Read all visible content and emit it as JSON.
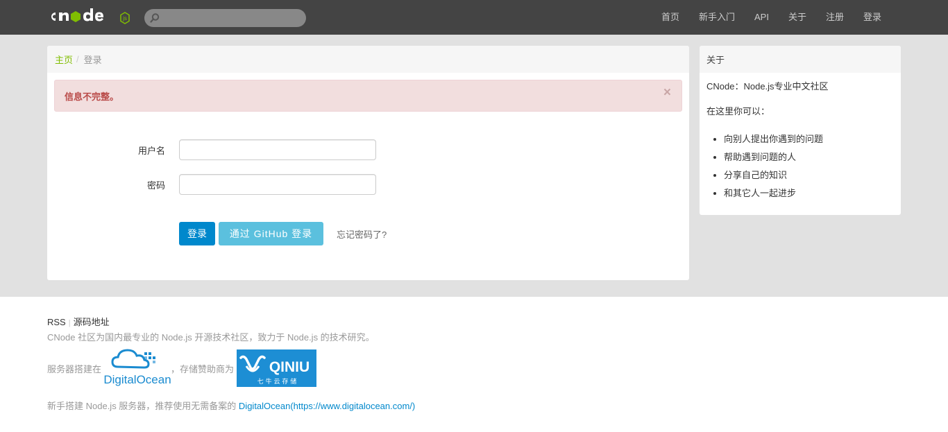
{
  "navbar": {
    "brand_logo": "cnode-logo",
    "search_placeholder": "",
    "items": [
      "首页",
      "新手入门",
      "API",
      "关于",
      "注册",
      "登录"
    ]
  },
  "breadcrumb": {
    "home": "主页",
    "separator": "/",
    "current": "登录"
  },
  "alert": {
    "message": "信息不完整。",
    "close": "×"
  },
  "form": {
    "username_label": "用户名",
    "username_value": "",
    "password_label": "密码",
    "password_value": "",
    "login_button": "登录",
    "github_button": "通过 GitHub 登录",
    "forgot_link": "忘记密码了?"
  },
  "sidebar": {
    "title": "关于",
    "intro": "CNode：Node.js专业中文社区",
    "subtitle": "在这里你可以：",
    "items": [
      "向别人提出你遇到的问题",
      "帮助遇到问题的人",
      "分享自己的知识",
      "和其它人一起进步"
    ]
  },
  "footer": {
    "rss": "RSS",
    "divider": "|",
    "source": "源码地址",
    "description": "CNode 社区为国内最专业的 Node.js 开源技术社区，致力于 Node.js 的技术研究。",
    "server_text": "服务器搭建在",
    "digitalocean_text": "DigitalOcean",
    "storage_text": "，存储赞助商为",
    "qiniu_text": "QINIU",
    "qiniu_subtext": "七 牛 云 存 储",
    "newbie_text": "新手搭建 Node.js 服务器，推荐使用无需备案的 ",
    "newbie_link": "DigitalOcean(https://www.digitalocean.com/)"
  },
  "colors": {
    "navbar_bg": "#444444",
    "accent_green": "#80bd01",
    "alert_bg": "#f2dede",
    "alert_text": "#b94a48",
    "primary_button": "#0088cc",
    "github_button": "#5bc0de",
    "link_blue": "#0088cc"
  }
}
